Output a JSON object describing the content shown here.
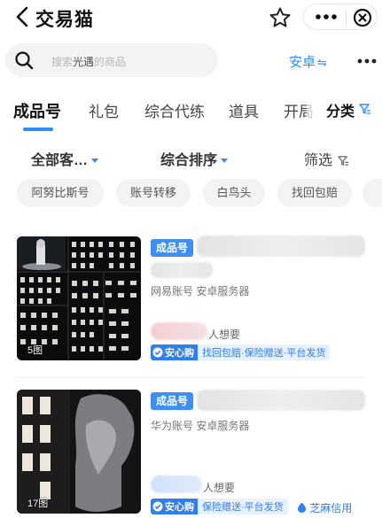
{
  "header": {
    "title": "交易猫"
  },
  "search": {
    "placeholder_pre": "搜索",
    "placeholder_key": "光遇",
    "placeholder_post": "的商品",
    "platform": "安卓",
    "platform_swap": "⇋"
  },
  "tabs": [
    "成品号",
    "礼包",
    "综合代练",
    "道具",
    "开局"
  ],
  "category": {
    "label": "分类"
  },
  "filters": {
    "client": "全部客…",
    "sort": "综合排序",
    "screen": "筛选"
  },
  "chips": [
    "阿努比斯号",
    "账号转移",
    "白鸟头",
    "找回包赔"
  ],
  "listings": [
    {
      "type_badge": "成品号",
      "desc": "网易账号 安卓服务器",
      "wants": "人想要",
      "image_count": "5图",
      "safe_label": "安心购",
      "safe_tags": "找回包赔·保险赠送·平台发货"
    },
    {
      "type_badge": "成品号",
      "desc": "华为账号 安卓服务器",
      "wants": "人想要",
      "image_count": "17图",
      "safe_label": "安心购",
      "safe_tags": "保险赠送·平台发货",
      "credit": "芝麻信用"
    }
  ],
  "colors": {
    "accent": "#2f8cff",
    "badge": "#3d8ff5",
    "safe": "#2f7ff0"
  }
}
